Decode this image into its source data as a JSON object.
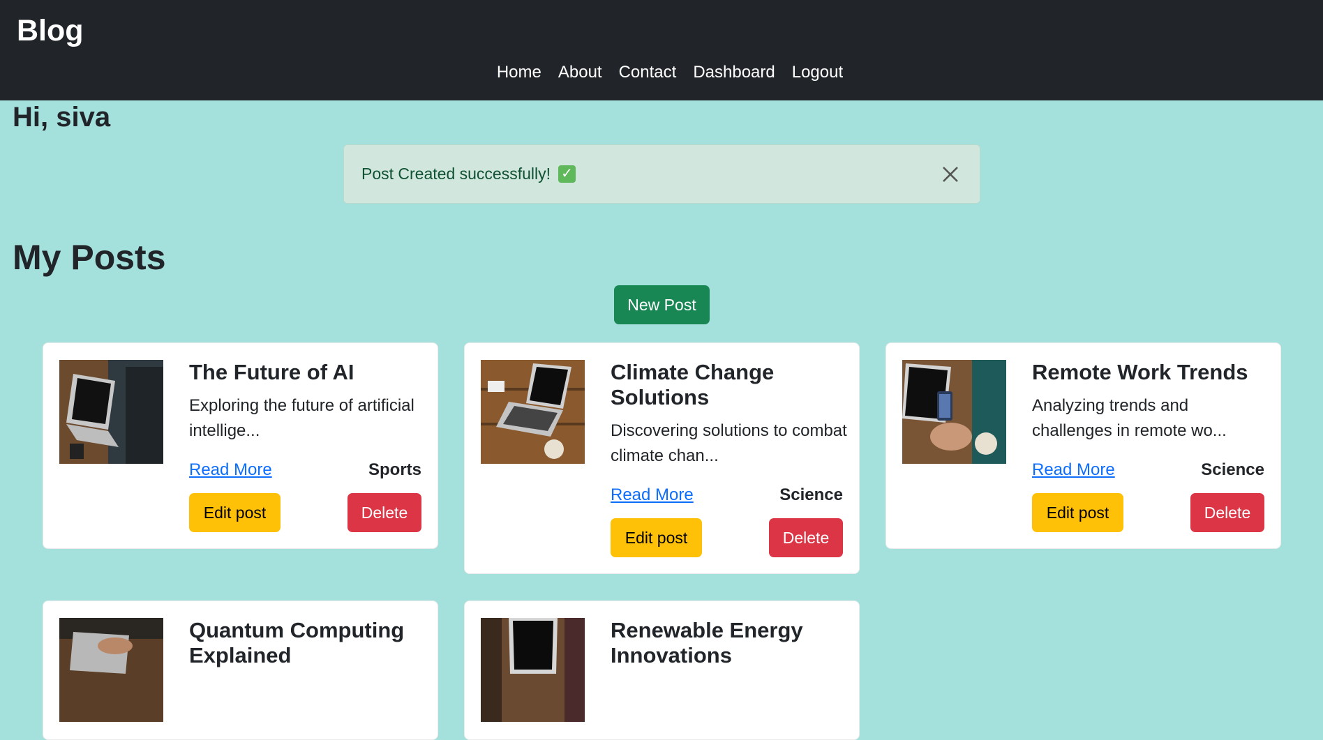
{
  "navbar": {
    "brand": "Blog",
    "links": [
      "Home",
      "About",
      "Contact",
      "Dashboard",
      "Logout"
    ]
  },
  "greeting": "Hi, siva",
  "alert": {
    "message": "Post Created successfully!",
    "check_glyph": "✓",
    "close_icon": "close-icon"
  },
  "section_title": "My Posts",
  "new_post_label": "New Post",
  "posts": [
    {
      "title": "The Future of AI",
      "excerpt": "Exploring the future of artificial intellige...",
      "read_more": "Read More",
      "category": "Sports",
      "edit_label": "Edit post",
      "delete_label": "Delete"
    },
    {
      "title": "Climate Change Solutions",
      "excerpt": "Discovering solutions to combat climate chan...",
      "read_more": "Read More",
      "category": "Science",
      "edit_label": "Edit post",
      "delete_label": "Delete"
    },
    {
      "title": "Remote Work Trends",
      "excerpt": "Analyzing trends and challenges in remote wo...",
      "read_more": "Read More",
      "category": "Science",
      "edit_label": "Edit post",
      "delete_label": "Delete"
    },
    {
      "title": "Quantum Computing Explained"
    },
    {
      "title": "Renewable Energy Innovations"
    }
  ],
  "colors": {
    "navbar_bg": "#212529",
    "page_bg": "#a4e0dc",
    "success": "#198754",
    "warning": "#ffc107",
    "danger": "#dc3545",
    "link": "#0d6efd"
  }
}
